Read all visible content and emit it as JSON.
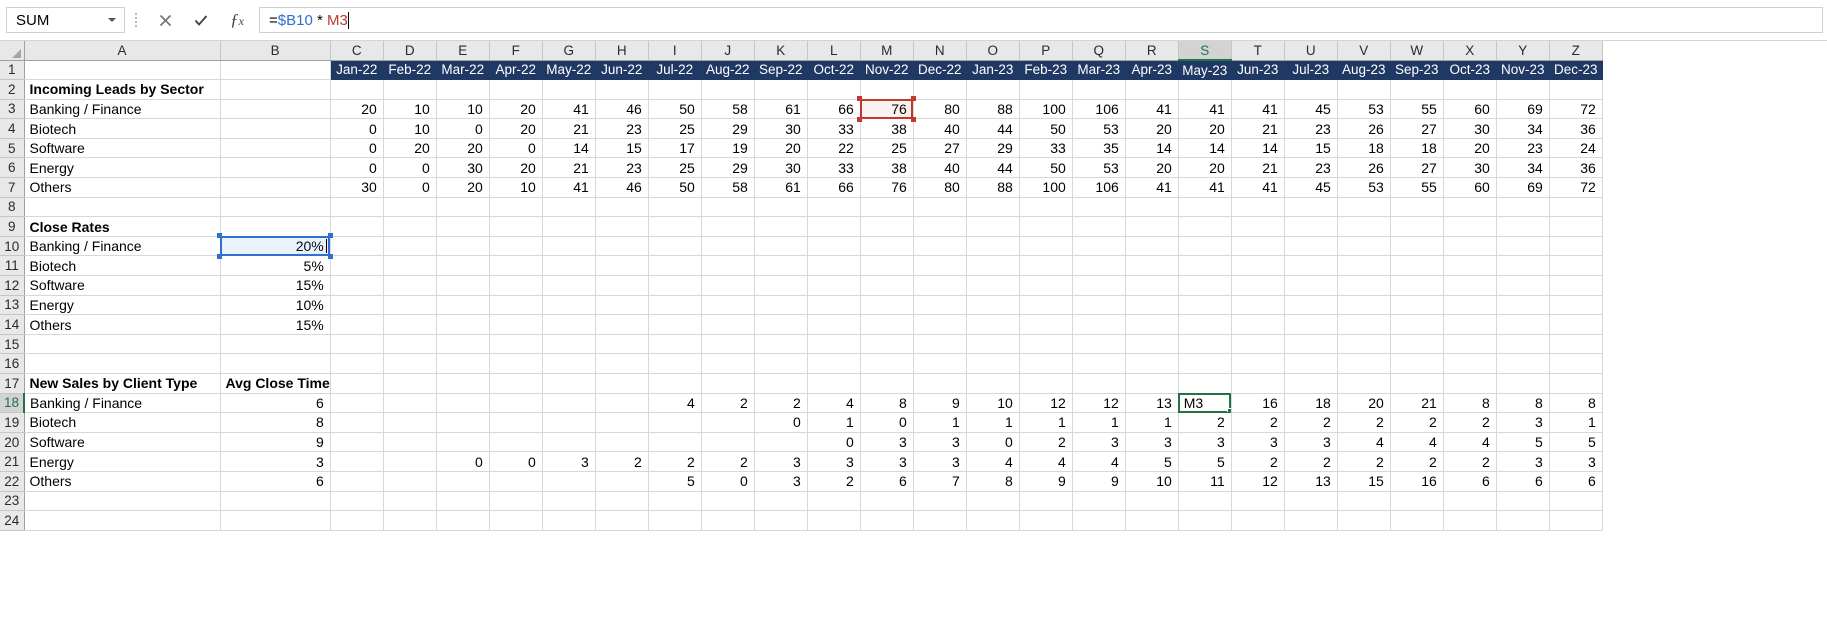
{
  "formula_bar": {
    "name_box_value": "SUM",
    "cancel_icon": "close-icon",
    "confirm_icon": "check-icon",
    "function_icon": "fx-icon",
    "formula_prefix": "=",
    "formula_ref_absolute": "$B10",
    "formula_operator": " * ",
    "formula_ref_relative": "M3",
    "formula_full": "=$B10 * M3"
  },
  "grid": {
    "active_cell": "S18",
    "active_column": "S",
    "active_row": 18,
    "columns": [
      "A",
      "B",
      "C",
      "D",
      "E",
      "F",
      "G",
      "H",
      "I",
      "J",
      "K",
      "L",
      "M",
      "N",
      "O",
      "P",
      "Q",
      "R",
      "S",
      "T",
      "U",
      "V",
      "W",
      "X",
      "Y",
      "Z"
    ],
    "rows": [
      1,
      2,
      3,
      4,
      5,
      6,
      7,
      8,
      9,
      10,
      11,
      12,
      13,
      14,
      15,
      16,
      17,
      18,
      19,
      20,
      21,
      22,
      23,
      24
    ],
    "colors": {
      "month_header_bg": "#1F3864",
      "month_header_fg": "#FFFFFF",
      "active_outline": "#217346",
      "ref_red": "#C0392B",
      "ref_blue": "#2F6FD0",
      "header_bg": "#E8E8E8",
      "gridline": "#D8D8D8"
    },
    "month_headers": [
      "Jan-22",
      "Feb-22",
      "Mar-22",
      "Apr-22",
      "May-22",
      "Jun-22",
      "Jul-22",
      "Aug-22",
      "Sep-22",
      "Oct-22",
      "Nov-22",
      "Dec-22",
      "Jan-23",
      "Feb-23",
      "Mar-23",
      "Apr-23",
      "May-23",
      "Jun-23",
      "Jul-23",
      "Aug-23",
      "Sep-23",
      "Oct-23",
      "Nov-23",
      "Dec-23"
    ],
    "section_titles": {
      "incoming_leads": "Incoming Leads by Sector",
      "close_rates": "Close Rates",
      "new_sales": "New Sales by Client Type",
      "avg_close_time": "Avg Close Time"
    },
    "incoming_leads": {
      "labels": [
        "Banking / Finance",
        "Biotech",
        "Software",
        "Energy",
        "Others"
      ],
      "values": [
        [
          20,
          10,
          10,
          20,
          41,
          46,
          50,
          58,
          61,
          66,
          76,
          80,
          88,
          100,
          106,
          41,
          41,
          41,
          45,
          53,
          55,
          60,
          69,
          72
        ],
        [
          0,
          10,
          0,
          20,
          21,
          23,
          25,
          29,
          30,
          33,
          38,
          40,
          44,
          50,
          53,
          20,
          20,
          21,
          23,
          26,
          27,
          30,
          34,
          36
        ],
        [
          0,
          20,
          20,
          0,
          14,
          15,
          17,
          19,
          20,
          22,
          25,
          27,
          29,
          33,
          35,
          14,
          14,
          14,
          15,
          18,
          18,
          20,
          23,
          24
        ],
        [
          0,
          0,
          30,
          20,
          21,
          23,
          25,
          29,
          30,
          33,
          38,
          40,
          44,
          50,
          53,
          20,
          20,
          21,
          23,
          26,
          27,
          30,
          34,
          36
        ],
        [
          30,
          0,
          20,
          10,
          41,
          46,
          50,
          58,
          61,
          66,
          76,
          80,
          88,
          100,
          106,
          41,
          41,
          41,
          45,
          53,
          55,
          60,
          69,
          72
        ]
      ]
    },
    "close_rates": {
      "labels": [
        "Banking / Finance",
        "Biotech",
        "Software",
        "Energy",
        "Others"
      ],
      "values": [
        "20%",
        "5%",
        "15%",
        "10%",
        "15%"
      ]
    },
    "new_sales": {
      "labels": [
        "Banking / Finance",
        "Biotech",
        "Software",
        "Energy",
        "Others"
      ],
      "avg_close_time": [
        6,
        8,
        9,
        3,
        6
      ],
      "values": [
        [
          "",
          "",
          "",
          "",
          "",
          "",
          4,
          2,
          2,
          4,
          8,
          9,
          10,
          12,
          12,
          13,
          "M3",
          16,
          18,
          20,
          21,
          8,
          8,
          8
        ],
        [
          "",
          "",
          "",
          "",
          "",
          "",
          "",
          "",
          0,
          1,
          0,
          1,
          1,
          1,
          1,
          1,
          2,
          2,
          2,
          2,
          2,
          2,
          3,
          1
        ],
        [
          "",
          "",
          "",
          "",
          "",
          "",
          "",
          "",
          "",
          0,
          3,
          3,
          0,
          2,
          3,
          3,
          3,
          3,
          3,
          4,
          4,
          4,
          5,
          5
        ],
        [
          "",
          "",
          0,
          0,
          3,
          2,
          2,
          2,
          3,
          3,
          3,
          3,
          4,
          4,
          4,
          5,
          5,
          2,
          2,
          2,
          2,
          2,
          3,
          3
        ],
        [
          "",
          "",
          "",
          "",
          "",
          "",
          5,
          0,
          3,
          2,
          6,
          7,
          8,
          9,
          9,
          10,
          11,
          12,
          13,
          15,
          16,
          6,
          6,
          6
        ]
      ]
    }
  }
}
